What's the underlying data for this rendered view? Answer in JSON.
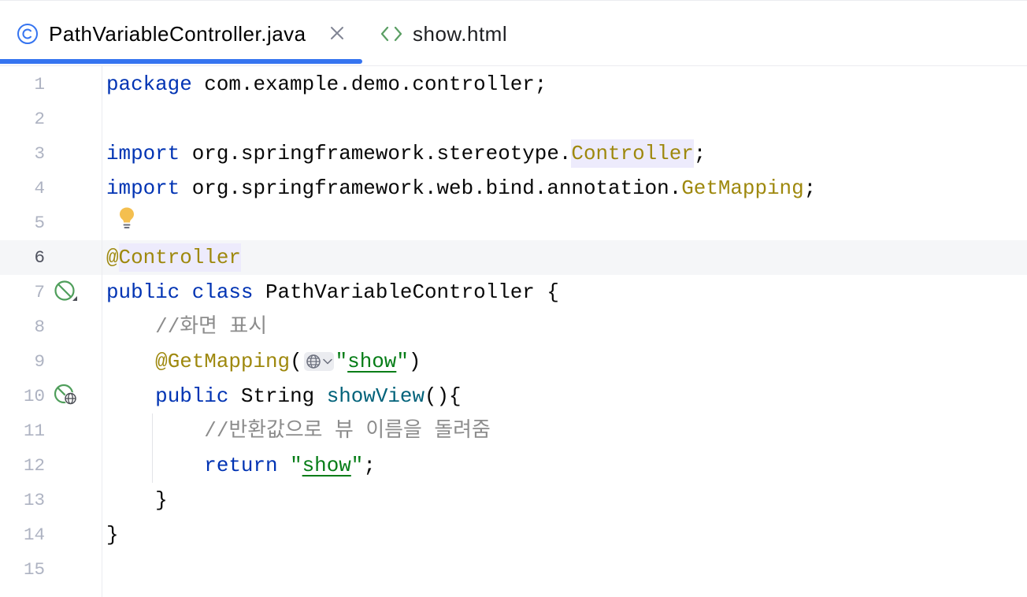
{
  "colors": {
    "accent": "#3574f0",
    "current_line_bg": "#f5f6f8",
    "line_number": "#aeb3c2",
    "current_line_number": "#505360"
  },
  "tabs": [
    {
      "label": "PathVariableController.java",
      "icon": "java-class-icon",
      "active": true,
      "close_icon": "close-icon"
    },
    {
      "label": "show.html",
      "icon": "html-file-icon",
      "active": false
    }
  ],
  "editor": {
    "current_line": 6,
    "lines": [
      {
        "number": "1",
        "tokens": [
          {
            "text": "package",
            "color": "#0033b3"
          },
          {
            "text": " com.example.demo.controller;",
            "color": "#080808"
          }
        ]
      },
      {
        "number": "2",
        "tokens": []
      },
      {
        "number": "3",
        "tokens": [
          {
            "text": "import",
            "color": "#0033b3"
          },
          {
            "text": " org.springframework.stereotype.",
            "color": "#080808"
          },
          {
            "text": "Controller",
            "color": "#9e880d",
            "bg": "#edebfc"
          },
          {
            "text": ";",
            "color": "#080808"
          }
        ]
      },
      {
        "number": "4",
        "tokens": [
          {
            "text": "import",
            "color": "#0033b3"
          },
          {
            "text": " org.springframework.web.bind.annotation.",
            "color": "#080808"
          },
          {
            "text": "GetMapping",
            "color": "#9e880d"
          },
          {
            "text": ";",
            "color": "#080808"
          }
        ]
      },
      {
        "number": "5",
        "bulb_icon": "intention-bulb-icon",
        "tokens": []
      },
      {
        "number": "6",
        "tokens": [
          {
            "text": "@",
            "color": "#9e880d"
          },
          {
            "text": "Controller",
            "color": "#9e880d",
            "bg": "#edebfc"
          }
        ]
      },
      {
        "number": "7",
        "gutter_icon": "spring-bean-icon",
        "tokens": [
          {
            "text": "public",
            "color": "#0033b3"
          },
          {
            "text": " ",
            "color": "#080808"
          },
          {
            "text": "class",
            "color": "#0033b3"
          },
          {
            "text": " PathVariableController {",
            "color": "#080808"
          }
        ]
      },
      {
        "number": "8",
        "tokens": [
          {
            "text": "    ",
            "color": "#080808"
          },
          {
            "text": "//화면 표시",
            "color": "#8c8c8c"
          }
        ]
      },
      {
        "number": "9",
        "tokens": [
          {
            "text": "    ",
            "color": "#080808"
          },
          {
            "text": "@GetMapping",
            "color": "#9e880d"
          },
          {
            "text": "(",
            "color": "#080808"
          },
          {
            "inlay": "globe-icon",
            "chevron": "chevron-down-icon"
          },
          {
            "text": "\"",
            "color": "#067d17"
          },
          {
            "text": "show",
            "color": "#067d17",
            "underline": true,
            "link": true
          },
          {
            "text": "\"",
            "color": "#067d17"
          },
          {
            "text": ")",
            "color": "#080808"
          }
        ]
      },
      {
        "number": "10",
        "gutter_icon": "spring-web-endpoint-icon",
        "tokens": [
          {
            "text": "    ",
            "color": "#080808"
          },
          {
            "text": "public",
            "color": "#0033b3"
          },
          {
            "text": " String ",
            "color": "#080808"
          },
          {
            "text": "showView",
            "color": "#00627a"
          },
          {
            "text": "(){",
            "color": "#080808"
          }
        ]
      },
      {
        "number": "11",
        "tokens": [
          {
            "text": "        ",
            "color": "#080808"
          },
          {
            "text": "//반환값으로 뷰 이름을 돌려줌",
            "color": "#8c8c8c"
          }
        ]
      },
      {
        "number": "12",
        "tokens": [
          {
            "text": "        ",
            "color": "#080808"
          },
          {
            "text": "return",
            "color": "#0033b3"
          },
          {
            "text": " ",
            "color": "#080808"
          },
          {
            "text": "\"",
            "color": "#067d17"
          },
          {
            "text": "show",
            "color": "#067d17",
            "underline": true,
            "link": true
          },
          {
            "text": "\"",
            "color": "#067d17"
          },
          {
            "text": ";",
            "color": "#080808"
          }
        ]
      },
      {
        "number": "13",
        "tokens": [
          {
            "text": "    }",
            "color": "#080808"
          }
        ]
      },
      {
        "number": "14",
        "tokens": [
          {
            "text": "}",
            "color": "#080808"
          }
        ]
      },
      {
        "number": "15",
        "tokens": []
      }
    ]
  }
}
